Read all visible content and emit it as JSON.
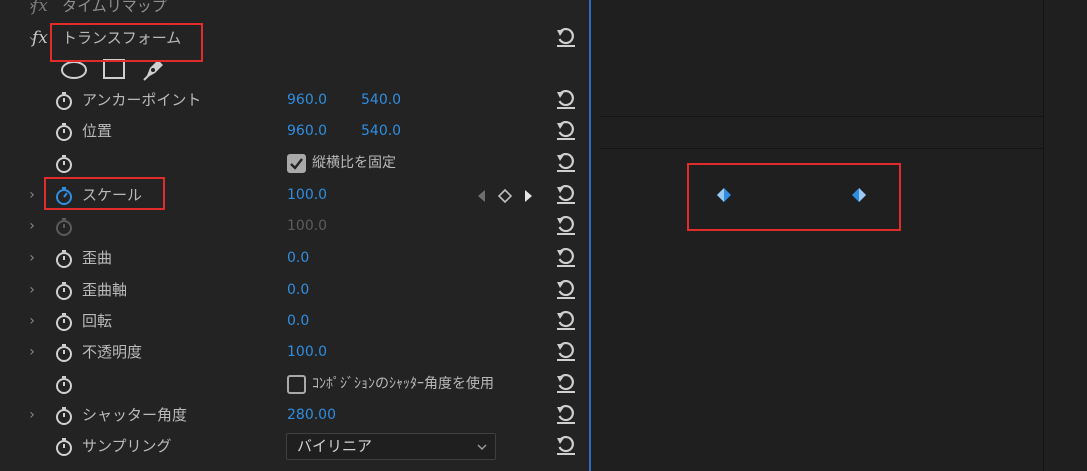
{
  "effects": {
    "time_remap": {
      "fx": "fx",
      "label": "タイムリマップ"
    },
    "transform": {
      "fx": "fx",
      "label": "トランスフォーム"
    }
  },
  "properties": {
    "anchor": {
      "label": "アンカーポイント",
      "x": "960.0",
      "y": "540.0"
    },
    "position": {
      "label": "位置",
      "x": "960.0",
      "y": "540.0"
    },
    "aspect": {
      "label": "縦横比を固定",
      "checked": true
    },
    "scale": {
      "label": "スケール",
      "value": "100.0"
    },
    "scale_width": {
      "value": "100.0"
    },
    "skew": {
      "label": "歪曲",
      "value": "0.0"
    },
    "skew_axis": {
      "label": "歪曲軸",
      "value": "0.0"
    },
    "rotation": {
      "label": "回転",
      "value": "0.0"
    },
    "opacity": {
      "label": "不透明度",
      "value": "100.0"
    },
    "use_comp_shutter": {
      "label": "ｺﾝﾎﾟｼﾞｼｮﾝのｼｬｯﾀｰ角度を使用",
      "checked": false
    },
    "shutter_angle": {
      "label": "シャッター角度",
      "value": "280.00"
    },
    "sampling": {
      "label": "サンプリング",
      "value": "バイリニア"
    }
  },
  "keyframes": {
    "scale": [
      {
        "time_label": "keyframe-1"
      },
      {
        "time_label": "keyframe-2"
      }
    ]
  },
  "colors": {
    "value_blue": "#2f8ee0",
    "highlight_red": "#e22c2c",
    "playhead": "#2d6bc4"
  }
}
